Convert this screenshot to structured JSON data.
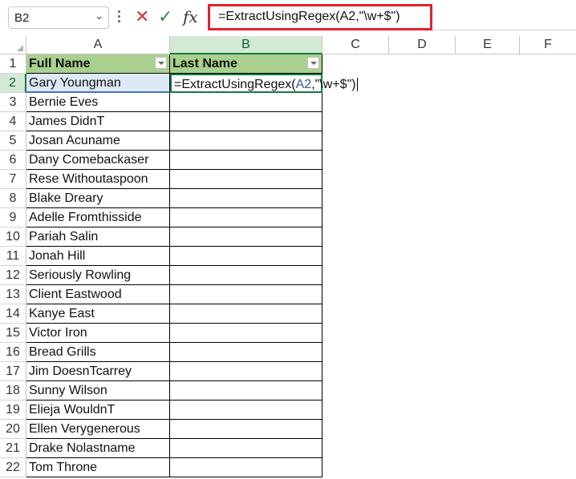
{
  "formula_bar": {
    "name_box": "B2",
    "formula": "=ExtractUsingRegex(A2,\"\\w+$\")",
    "formula_prefix": "=ExtractUsingRegex(",
    "formula_ref": "A2",
    "formula_suffix": ",\"\\w+$\")",
    "highlight_color": "#e4202e"
  },
  "columns": [
    "A",
    "B",
    "C",
    "D",
    "E",
    "F"
  ],
  "selected_column": "B",
  "selected_row": 2,
  "rows": [
    "1",
    "2",
    "3",
    "4",
    "5",
    "6",
    "7",
    "8",
    "9",
    "10",
    "11",
    "12",
    "13",
    "14",
    "15",
    "16",
    "17",
    "18",
    "19",
    "20",
    "21",
    "22"
  ],
  "table": {
    "header_a": "Full Name",
    "header_b": "Last Name",
    "header_color": "#a9d08e",
    "full_names": [
      "Gary Youngman",
      "Bernie Eves",
      "James DidnT",
      "Josan Acuname",
      "Dany Comebackaser",
      "Rese Withoutaspoon",
      "Blake Dreary",
      "Adelle Fromthisside",
      "Pariah Salin",
      "Jonah Hill",
      "Seriously Rowling",
      "Client Eastwood",
      "Kanye East",
      "Victor Iron",
      "Bread Grills",
      "Jim DoesnTcarrey",
      "Sunny Wilson",
      "Elieja WouldnT",
      "Ellen Verygenerous",
      "Drake Nolastname",
      "Tom Throne"
    ]
  },
  "icons": {
    "name_box_dropdown": "chevron-down-icon",
    "cancel": "cancel-x-icon",
    "enter": "check-icon",
    "function": "fx-icon"
  }
}
